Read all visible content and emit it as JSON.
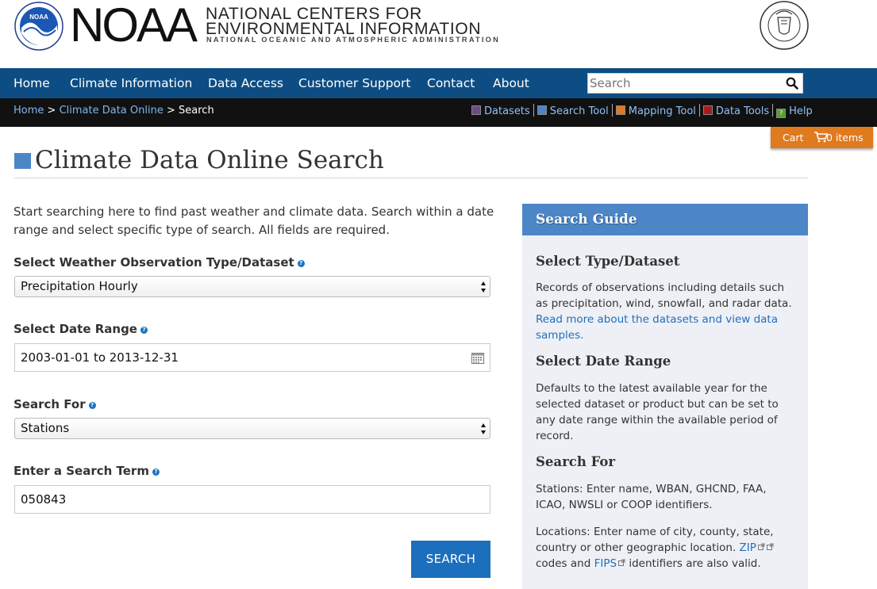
{
  "header": {
    "logo_badge": "NOAA",
    "brand": "NOAA",
    "ncei_line1": "NATIONAL CENTERS FOR",
    "ncei_line2": "ENVIRONMENTAL INFORMATION",
    "ncei_line3": "NATIONAL OCEANIC AND ATMOSPHERIC ADMINISTRATION"
  },
  "nav": {
    "items": [
      "Home",
      "Climate Information",
      "Data Access",
      "Customer Support",
      "Contact",
      "About"
    ],
    "search_placeholder": "Search"
  },
  "breadcrumb": {
    "home": "Home",
    "sep1": ">",
    "cdo": "Climate Data Online",
    "sep2": ">",
    "current": "Search"
  },
  "tools": [
    {
      "label": "Datasets",
      "color": "#6b4c86"
    },
    {
      "label": "Search Tool",
      "color": "#4c86c7"
    },
    {
      "label": "Mapping Tool",
      "color": "#e07a1e"
    },
    {
      "label": "Data Tools",
      "color": "#a51c1c"
    },
    {
      "label": "Help",
      "color": "#5aa02c"
    }
  ],
  "cart": {
    "label": "Cart",
    "count": "0 items"
  },
  "page": {
    "title": "Climate Data Online Search",
    "intro": "Start searching here to find past weather and climate data. Search within a date range and select specific type of search. All fields are required."
  },
  "form": {
    "dataset_label": "Select Weather Observation Type/Dataset",
    "dataset_value": "Precipitation Hourly",
    "date_label": "Select Date Range",
    "date_value": "2003-01-01 to 2013-12-31",
    "searchfor_label": "Search For",
    "searchfor_value": "Stations",
    "term_label": "Enter a Search Term",
    "term_value": "050843",
    "submit": "SEARCH",
    "help_glyph": "?"
  },
  "guide": {
    "title": "Search Guide",
    "s1_title": "Select Type/Dataset",
    "s1_text": "Records of observations including details such as precipitation, wind, snowfall, and radar data.",
    "s1_link": "Read more about the datasets and view data samples.",
    "s2_title": "Select Date Range",
    "s2_text": "Defaults to the latest available year for the selected dataset or product but can be set to any date range within the available period of record.",
    "s3_title": "Search For",
    "s3_text1": "Stations: Enter name, WBAN, GHCND, FAA, ICAO, NWSLI or COOP identifiers.",
    "s3_text2a": "Locations: Enter name of city, county, state, country or other geographic location.",
    "zip": "ZIP",
    "s3_text2b": "codes and",
    "fips": "FIPS",
    "s3_text2c": "identifiers are also valid."
  }
}
